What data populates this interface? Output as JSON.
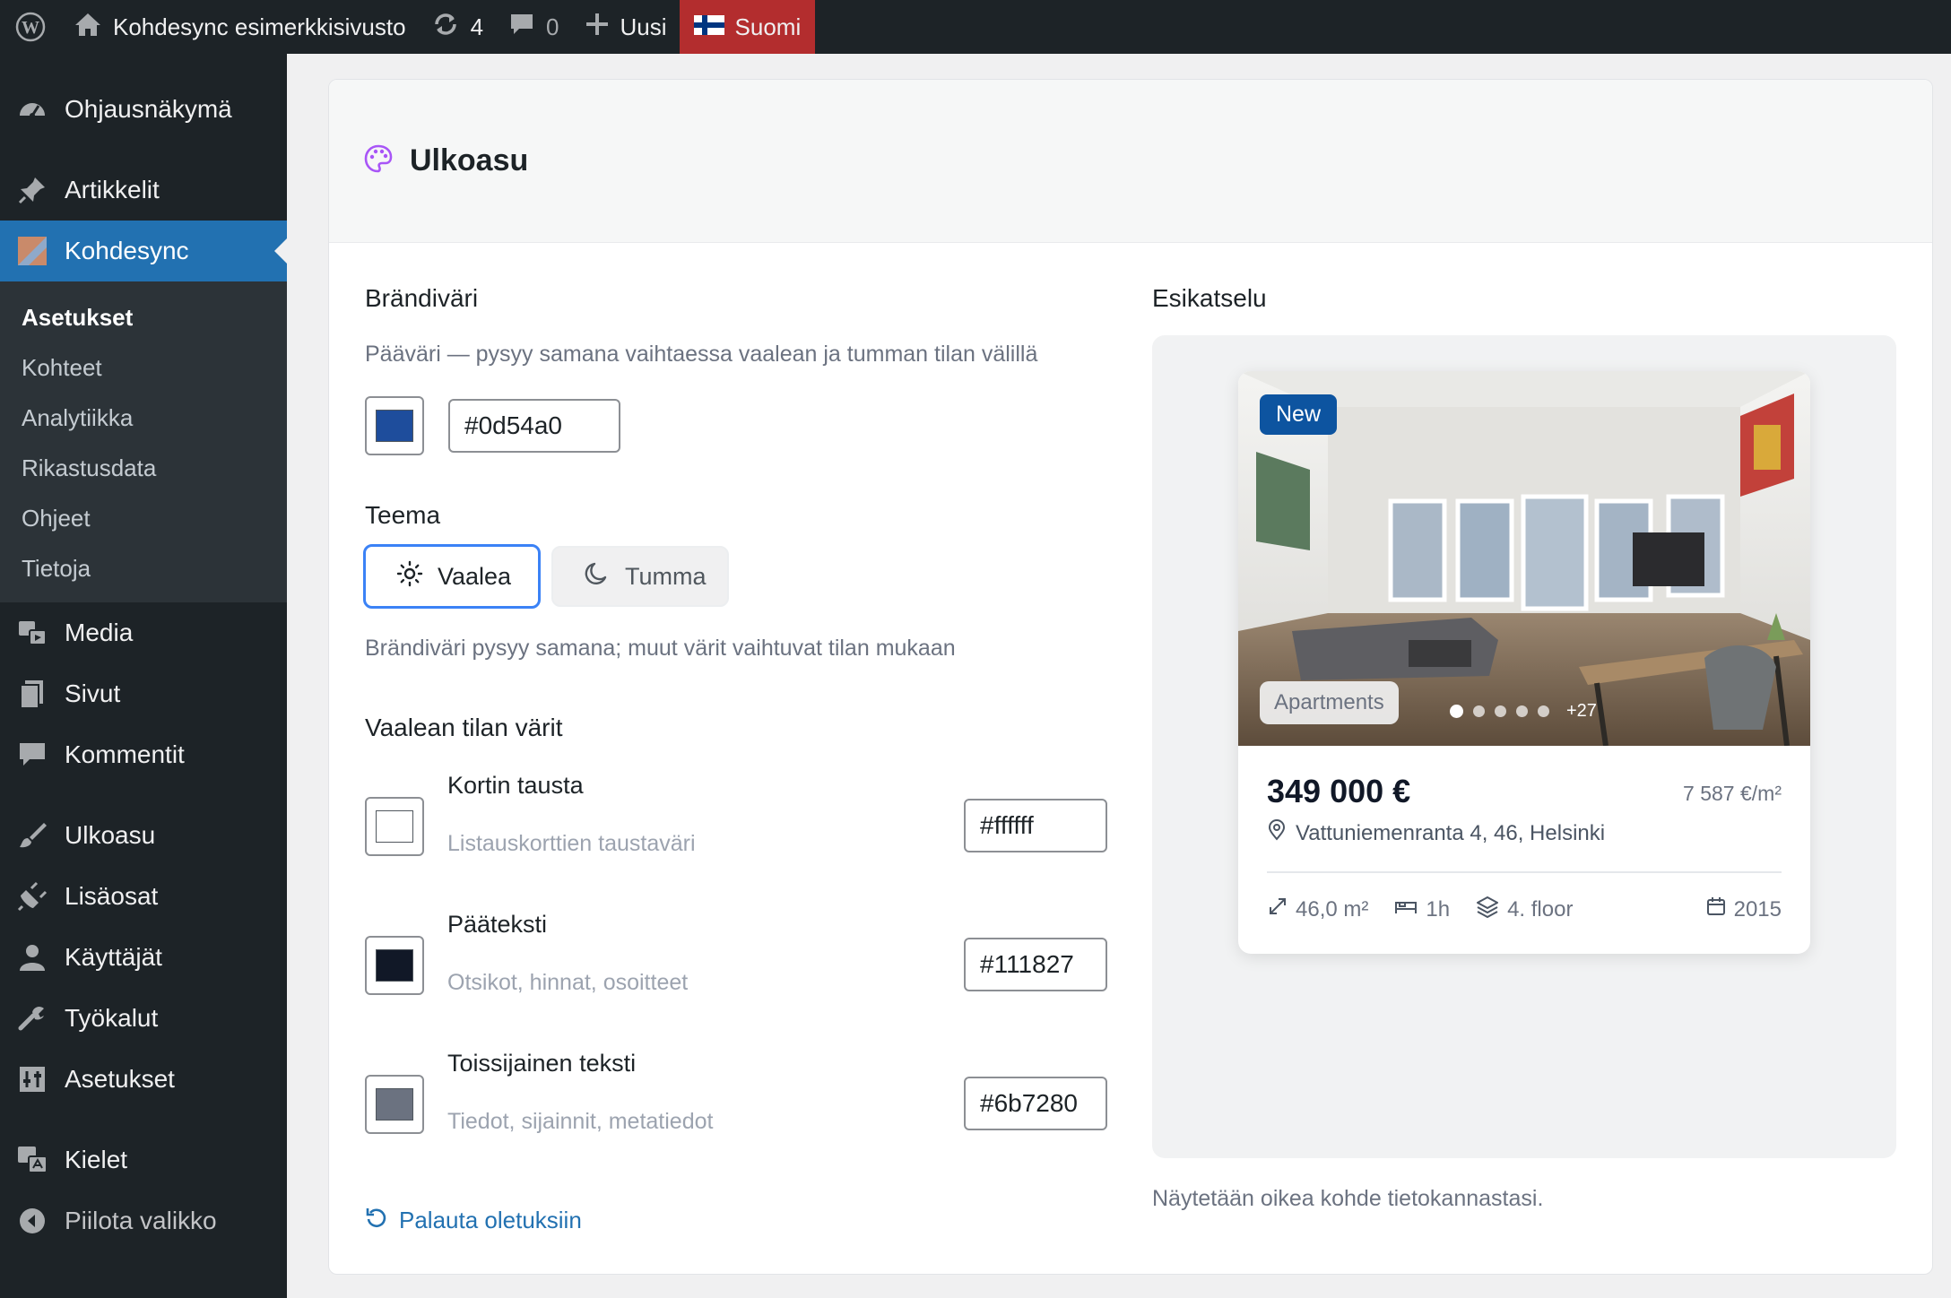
{
  "admin_bar": {
    "site_name": "Kohdesync esimerkkisivusto",
    "updates_count": "4",
    "comments_count": "0",
    "new_label": "Uusi",
    "language": "Suomi"
  },
  "sidebar": {
    "items": [
      {
        "label": "Ohjausnäkymä",
        "icon": "dashboard-icon"
      },
      {
        "label": "Artikkelit",
        "icon": "pin-icon"
      },
      {
        "label": "Kohdesync",
        "icon": "plugin-logo-icon"
      },
      {
        "label": "Media",
        "icon": "media-icon"
      },
      {
        "label": "Sivut",
        "icon": "pages-icon"
      },
      {
        "label": "Kommentit",
        "icon": "comment-icon"
      },
      {
        "label": "Ulkoasu",
        "icon": "brush-icon"
      },
      {
        "label": "Lisäosat",
        "icon": "plug-icon"
      },
      {
        "label": "Käyttäjät",
        "icon": "user-icon"
      },
      {
        "label": "Työkalut",
        "icon": "wrench-icon"
      },
      {
        "label": "Asetukset",
        "icon": "settings-icon"
      },
      {
        "label": "Kielet",
        "icon": "translate-icon"
      },
      {
        "label": "Piilota valikko",
        "icon": "collapse-icon"
      }
    ],
    "submenu": [
      "Asetukset",
      "Kohteet",
      "Analytiikka",
      "Rikastusdata",
      "Ohjeet",
      "Tietoja"
    ]
  },
  "card": {
    "title": "Ulkoasu",
    "brand": {
      "heading": "Brändiväri",
      "help": "Pääväri — pysyy samana vaihtaessa vaalean ja tumman tilan välillä",
      "value": "#0d54a0",
      "color": "#1e4d9c"
    },
    "theme": {
      "heading": "Teema",
      "light_label": "Vaalea",
      "dark_label": "Tumma",
      "selected": "Vaalea",
      "help": "Brändiväri pysyy samana; muut värit vaihtuvat tilan mukaan"
    },
    "light_colors": {
      "heading": "Vaalean tilan värit",
      "rows": [
        {
          "title": "Kortin tausta",
          "desc": "Listauskorttien taustaväri",
          "value": "#ffffff"
        },
        {
          "title": "Pääteksti",
          "desc": "Otsikot, hinnat, osoitteet",
          "value": "#111827"
        },
        {
          "title": "Toissijainen teksti",
          "desc": "Tiedot, sijainnit, metatiedot",
          "value": "#6b7280"
        }
      ]
    },
    "reset_label": "Palauta oletuksiin",
    "preview": {
      "heading": "Esikatselu",
      "badge_new": "New",
      "category": "Apartments",
      "more_photos": "+27",
      "price": "349 000 €",
      "price_per_sqm": "7 587 €/m²",
      "address": "Vattuniemenranta 4, 46, Helsinki",
      "area": "46,0 m²",
      "rooms": "1h",
      "floor": "4. floor",
      "year": "2015",
      "note": "Näytetään oikea kohde tietokannastasi."
    }
  }
}
